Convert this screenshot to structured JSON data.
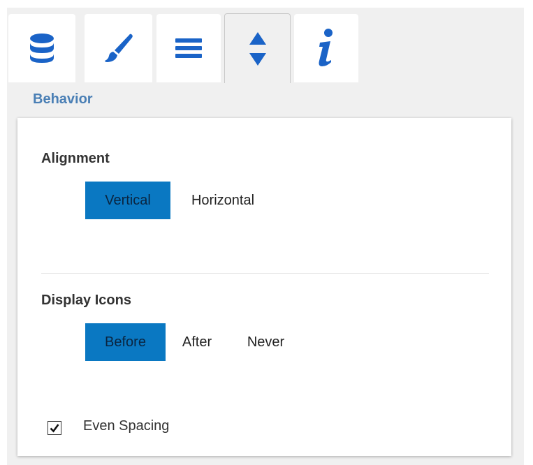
{
  "tabs": [
    {
      "id": "data",
      "icon": "database-icon",
      "active": false
    },
    {
      "id": "style",
      "icon": "brush-icon",
      "active": false
    },
    {
      "id": "list",
      "icon": "list-icon",
      "active": false
    },
    {
      "id": "behavior",
      "icon": "sort-arrows-icon",
      "active": true
    },
    {
      "id": "info",
      "icon": "info-icon",
      "active": false
    }
  ],
  "colors": {
    "accent": "#0a78c2",
    "icon": "#1a63c7",
    "section_title": "#4a7fb5",
    "panel_bg": "#f0f0f0"
  },
  "section_title": "Behavior",
  "alignment": {
    "label": "Alignment",
    "options": [
      "Vertical",
      "Horizontal"
    ],
    "selected": "Vertical"
  },
  "display_icons": {
    "label": "Display Icons",
    "options": [
      "Before",
      "After",
      "Never"
    ],
    "selected": "Before"
  },
  "even_spacing": {
    "label": "Even Spacing",
    "checked": true
  }
}
